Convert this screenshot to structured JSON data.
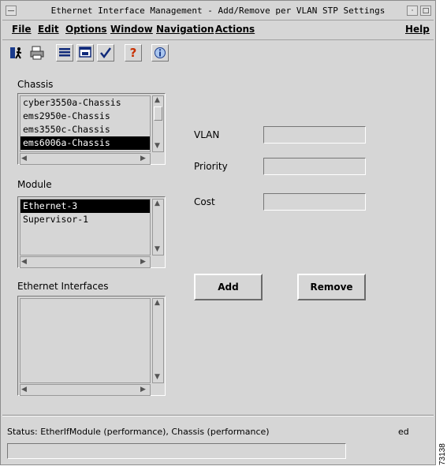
{
  "window": {
    "title": "Ethernet Interface Management - Add/Remove per VLAN STP Settings",
    "menu": {
      "file": "File",
      "edit": "Edit",
      "options": "Options",
      "window": "Window",
      "navigation": "Navigation",
      "actions": "Actions",
      "help": "Help"
    }
  },
  "chassis": {
    "label": "Chassis",
    "items": [
      "cyber3550a-Chassis",
      "ems2950e-Chassis",
      "ems3550c-Chassis",
      "ems6006a-Chassis"
    ],
    "selected_index": 3
  },
  "module": {
    "label": "Module",
    "items": [
      "Ethernet-3",
      "Supervisor-1"
    ],
    "selected_index": 0
  },
  "interfaces": {
    "label": "Ethernet Interfaces",
    "items": []
  },
  "form": {
    "vlan_label": "VLAN",
    "vlan_value": "",
    "priority_label": "Priority",
    "priority_value": "",
    "cost_label": "Cost",
    "cost_value": ""
  },
  "buttons": {
    "add": "Add",
    "remove": "Remove"
  },
  "status": {
    "text": "Status: EtherIfModule (performance), Chassis (performance)",
    "trailing": "ed",
    "bar_value": ""
  },
  "figure_number": "73138"
}
